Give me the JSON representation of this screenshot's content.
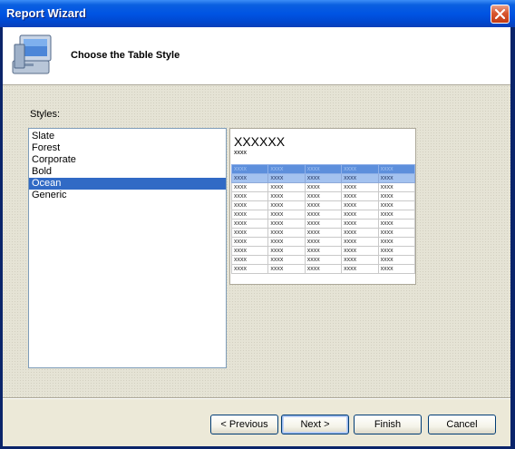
{
  "window": {
    "title": "Report Wizard"
  },
  "header": {
    "step_title": "Choose the Table Style",
    "icon": "computer-icon"
  },
  "styles": {
    "label": "Styles:",
    "items": [
      "Slate",
      "Forest",
      "Corporate",
      "Bold",
      "Ocean",
      "Generic"
    ],
    "selected": "Ocean"
  },
  "preview": {
    "title": "XXXXXX",
    "subtitle": "xxxx",
    "cell": "xxxx",
    "header_color": "#5d8fdc",
    "highlight_color": "#a4c2ef"
  },
  "buttons": {
    "previous": "< Previous",
    "next": "Next >",
    "finish": "Finish",
    "cancel": "Cancel"
  },
  "colors": {
    "selection": "#316ac5",
    "titlebar": "#0054e3",
    "close": "#d8562f"
  }
}
